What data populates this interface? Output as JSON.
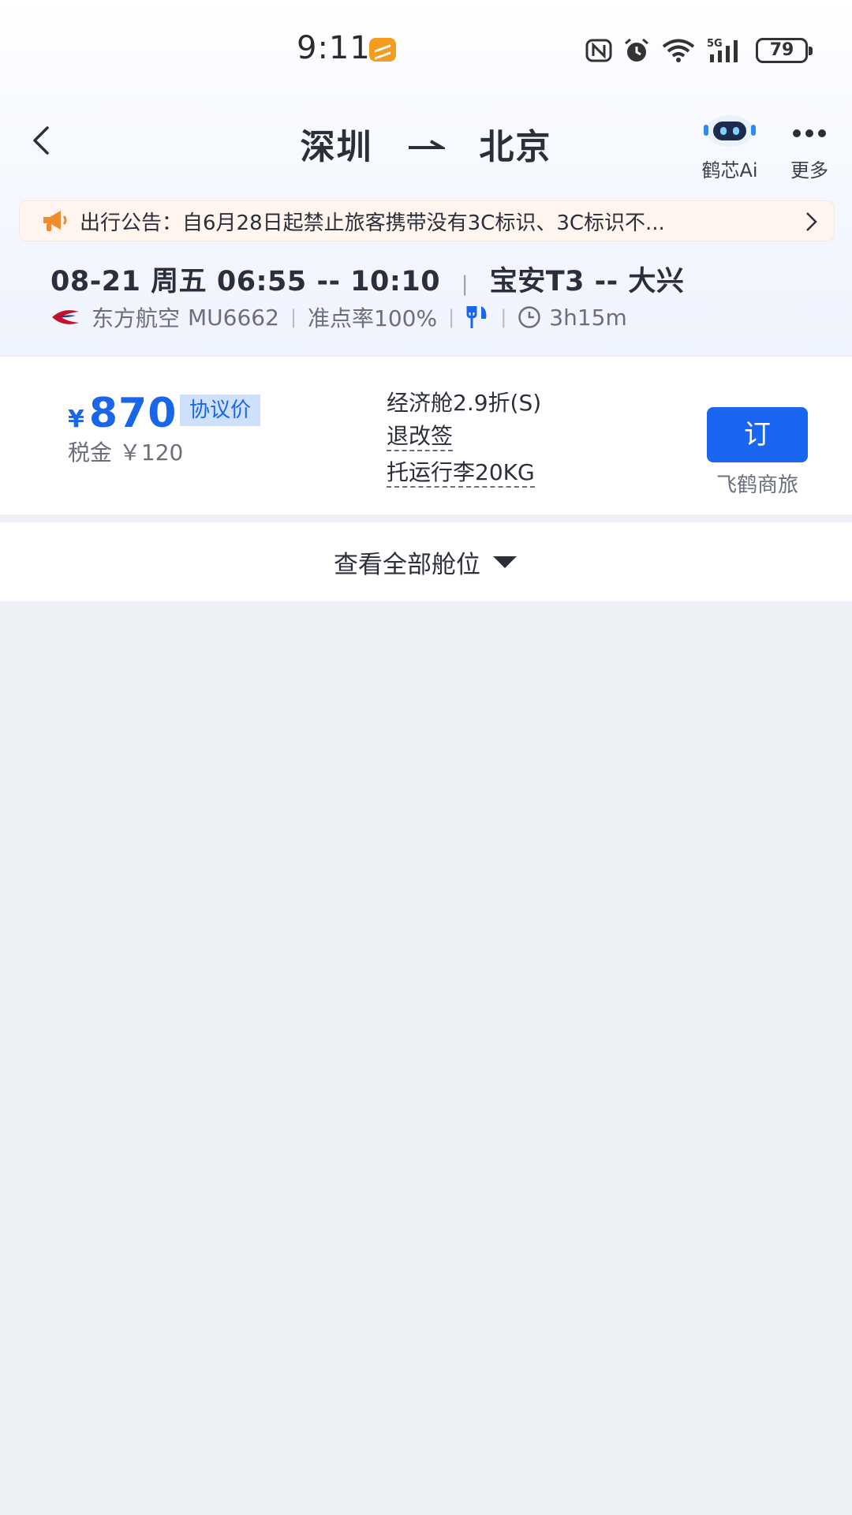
{
  "status_bar": {
    "time": "9:11",
    "signal_label": "5G",
    "battery": "79"
  },
  "nav": {
    "from": "深圳",
    "to": "北京",
    "ai_label": "鹤芯Ai",
    "more_label": "更多"
  },
  "notice": {
    "text": "出行公告：自6月28日起禁止旅客携带没有3C标识、3C标识不..."
  },
  "flight": {
    "date": "08-21",
    "weekday": "周五",
    "times": "06:55 -- 10:10",
    "airports": "宝安T3 -- 大兴",
    "airline": "东方航空",
    "flight_no": "MU6662",
    "on_time_rate": "准点率100%",
    "duration": "3h15m"
  },
  "fare": {
    "currency": "¥",
    "price": "870",
    "tag": "协议价",
    "tax": "税金 ￥120",
    "cabin": "经济舱2.9折(S)",
    "refund_change": "退改签",
    "baggage": "托运行李20KG",
    "book_label": "订",
    "provider": "飞鹤商旅"
  },
  "view_all_label": "查看全部舱位",
  "colors": {
    "accent": "#1a66f0",
    "tag_bg": "#cfe0fb",
    "notice_bg": "#fff4ee",
    "notice_icon": "#f28a2e",
    "page_bg": "#eceff4"
  }
}
